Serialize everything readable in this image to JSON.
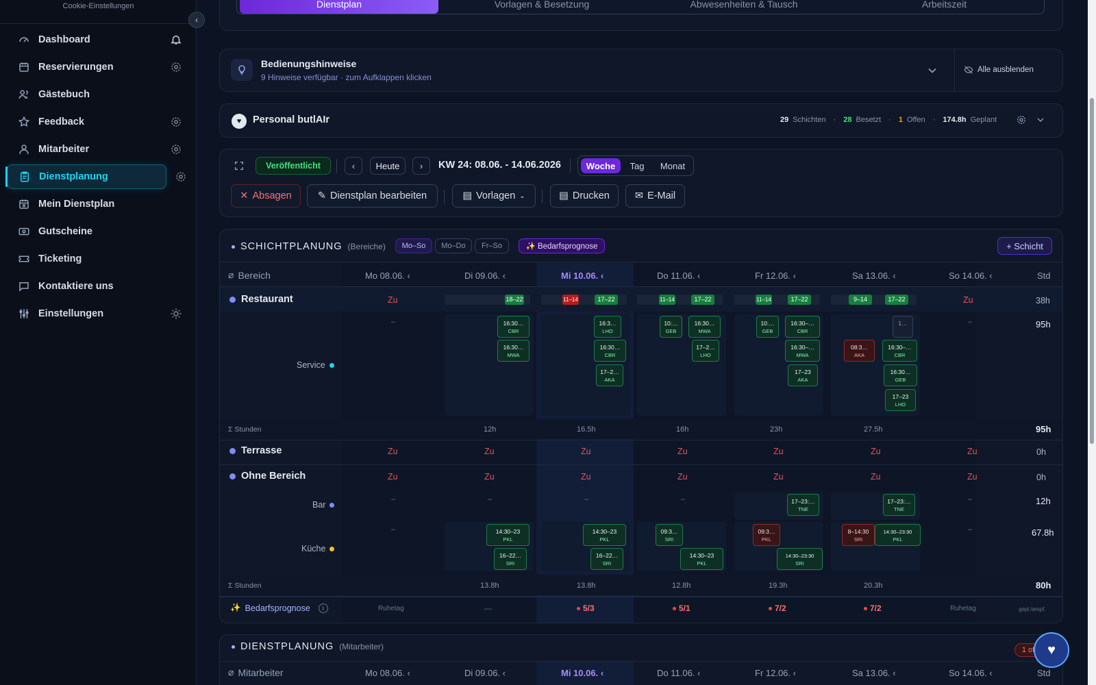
{
  "sidebar": {
    "top_text": "Cookie-Einstellungen",
    "items": [
      {
        "label": "Dashboard"
      },
      {
        "label": "Reservierungen"
      },
      {
        "label": "Gästebuch"
      },
      {
        "label": "Feedback"
      },
      {
        "label": "Mitarbeiter"
      },
      {
        "label": "Dienstplanung"
      },
      {
        "label": "Mein Dienstplan"
      },
      {
        "label": "Gutscheine"
      },
      {
        "label": "Ticketing"
      },
      {
        "label": "Kontaktiere uns"
      },
      {
        "label": "Einstellungen"
      }
    ]
  },
  "tabs": [
    "Dienstplan",
    "Vorlagen & Besetzung",
    "Abwesenheiten & Tausch",
    "Arbeitszeit"
  ],
  "hints": {
    "title": "Bedienungshinweise",
    "subtitle": "9 Hinweise verfügbar · zum Aufklappen klicken",
    "hide_all": "Alle ausblenden"
  },
  "personal": {
    "title": "Personal butlAIr",
    "shifts_n": "29",
    "shifts_l": "Schichten",
    "filled_n": "28",
    "filled_l": "Besetzt",
    "open_n": "1",
    "open_l": "Offen",
    "planned_n": "174.8h",
    "planned_l": "Geplant"
  },
  "toolbar": {
    "status": "Veröffentlicht",
    "today": "Heute",
    "week": "KW 24: 08.06. - 14.06.2026",
    "views": [
      "Woche",
      "Tag",
      "Monat"
    ],
    "cancel": "Absagen",
    "edit": "Dienstplan bearbeiten",
    "templates": "Vorlagen",
    "print": "Drucken",
    "email": "E-Mail"
  },
  "schicht": {
    "title": "SCHICHTPLANUNG",
    "sub": "(Bereiche)",
    "filters": [
      "Mo–So",
      "Mo–Do",
      "Fr–So"
    ],
    "forecast": "✨ Bedarfsprognose",
    "add": "+ Schicht",
    "col_label": "Bereich",
    "std": "Std",
    "days": [
      "Mo 08.06.",
      "Di 09.06.",
      "Mi 10.06.",
      "Do 11.06.",
      "Fr 12.06.",
      "Sa 13.06.",
      "So 14.06."
    ],
    "restaurant": "Restaurant",
    "service": "Service",
    "terrasse": "Terrasse",
    "ohne": "Ohne Bereich",
    "bar": "Bar",
    "kueche": "Küche",
    "zu": "Zu",
    "sum_label": "Σ Stunden",
    "rest_std": "38h",
    "service_std": "95h",
    "sum1_std": "95h",
    "terr_std": "0h",
    "ohne_std": "0h",
    "bar_std": "12h",
    "kueche_std": "67.8h",
    "sum2_std": "80h",
    "sum1": [
      "12h",
      "16.5h",
      "16h",
      "23h",
      "27.5h"
    ],
    "sum2": [
      "13.8h",
      "13.8h",
      "12.8h",
      "19.3h",
      "20.3h"
    ],
    "bars": [
      "18–22",
      "11–14",
      "17–22",
      "11–14",
      "17–22",
      "11–14",
      "17–22",
      "9–14",
      "17–22"
    ],
    "service_chips": [
      [
        "16:30…",
        "CBR"
      ],
      [
        "16:30…",
        "MWA"
      ],
      [
        "16:3…",
        "LHO"
      ],
      [
        "16:30…",
        "CBR"
      ],
      [
        "17–2…",
        "AKA"
      ],
      [
        "10:…",
        "GEB"
      ],
      [
        "16:30…",
        "MWA"
      ],
      [
        "17–2…",
        "LHO"
      ],
      [
        "10:…",
        "GEB"
      ],
      [
        "16:30–…",
        "CBR"
      ],
      [
        "16:30–…",
        "MWA"
      ],
      [
        "17–23",
        "AKA"
      ],
      [
        "1…",
        ""
      ],
      [
        "08:3…",
        "AKA"
      ],
      [
        "16:30–…",
        "CBR"
      ],
      [
        "16:30…",
        "GEB"
      ],
      [
        "17–23",
        "LHO"
      ]
    ],
    "bar_chips": [
      [
        "17–23:…",
        "TNE"
      ],
      [
        "17–23:…",
        "TNE"
      ]
    ],
    "kueche_chips": [
      [
        "14:30–23",
        "PKL"
      ],
      [
        "16–22…",
        "SRI"
      ],
      [
        "14:30–23",
        "PKL"
      ],
      [
        "16–22…",
        "SRI"
      ],
      [
        "09:3…",
        "SRI"
      ],
      [
        "14:30–23",
        "PKL"
      ],
      [
        "09:3…",
        "PKL"
      ],
      [
        "14:30–23:30",
        "SRI"
      ],
      [
        "8–14:30",
        "SRI"
      ],
      [
        "14:30–23:30",
        "PKL"
      ]
    ],
    "dash": "–",
    "bedarf_label": "Bedarfsprognose",
    "ruhetag": "Ruhetag",
    "bedarf": [
      "—",
      "5/3",
      "5/1",
      "7/2",
      "7/2"
    ],
    "bedarf_foot": "gepl./empf."
  },
  "dienst": {
    "title": "DIENSTPLANUNG",
    "sub": "(Mitarbeiter)",
    "col_label": "Mitarbeiter",
    "badge": "1 of"
  },
  "colors": {
    "accent": "#22d3ee",
    "purple": "#8b5cf6",
    "green": "#22c55e",
    "red": "#ef4444"
  }
}
